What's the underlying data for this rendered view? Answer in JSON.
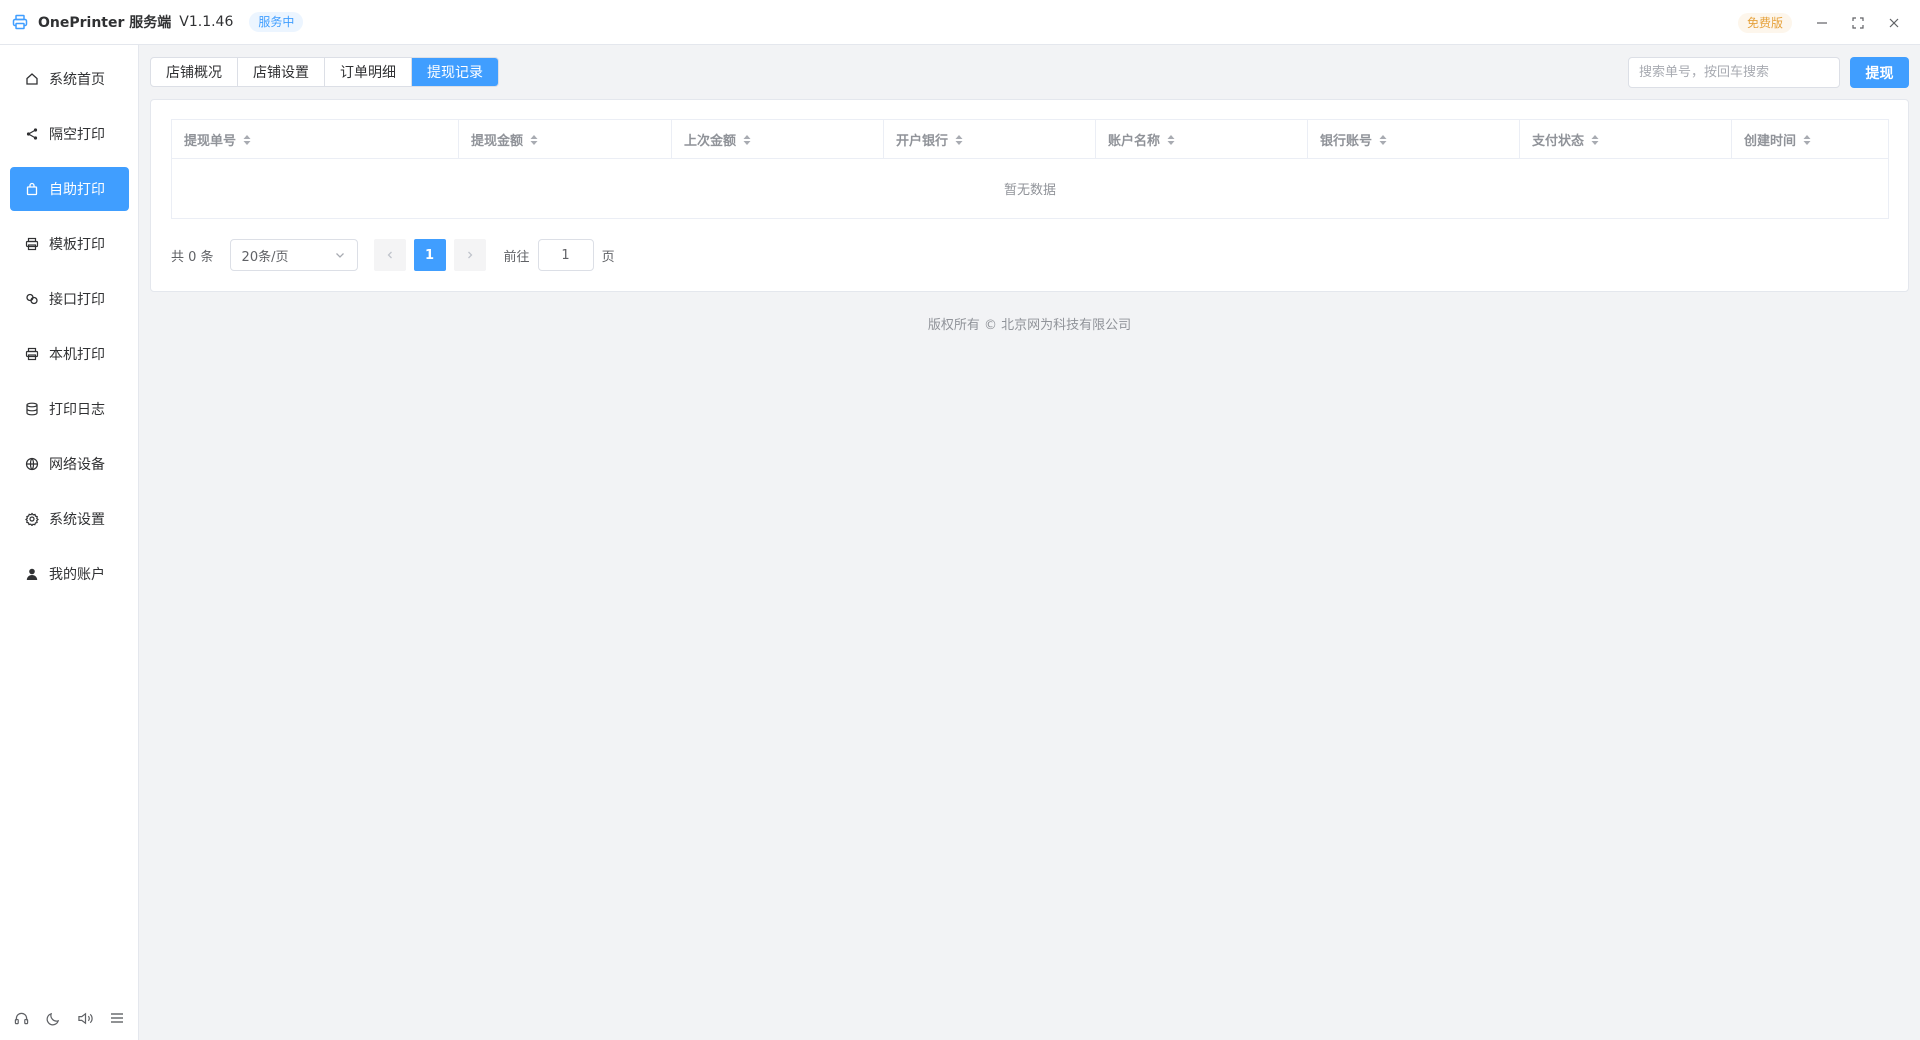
{
  "titlebar": {
    "app_name": "OnePrinter 服务端",
    "version": "V1.1.46",
    "status": "服务中",
    "edition": "免费版"
  },
  "sidebar": {
    "items": [
      {
        "label": "系统首页",
        "icon": "home-icon"
      },
      {
        "label": "隔空打印",
        "icon": "share-icon"
      },
      {
        "label": "自助打印",
        "icon": "shopping-bag-icon"
      },
      {
        "label": "模板打印",
        "icon": "printer-icon"
      },
      {
        "label": "接口打印",
        "icon": "link-icon"
      },
      {
        "label": "本机打印",
        "icon": "printer-icon"
      },
      {
        "label": "打印日志",
        "icon": "database-icon"
      },
      {
        "label": "网络设备",
        "icon": "network-icon"
      },
      {
        "label": "系统设置",
        "icon": "gear-icon"
      },
      {
        "label": "我的账户",
        "icon": "user-icon"
      }
    ],
    "active_index": 2,
    "footer_icons": [
      "headset-icon",
      "moon-icon",
      "speaker-icon",
      "menu-icon"
    ]
  },
  "tabs": [
    {
      "label": "店铺概况"
    },
    {
      "label": "店铺设置"
    },
    {
      "label": "订单明细"
    },
    {
      "label": "提现记录"
    }
  ],
  "active_tab": 3,
  "search": {
    "placeholder": "搜索单号，按回车搜索",
    "value": ""
  },
  "withdraw_button": "提现",
  "table": {
    "columns": [
      "提现单号",
      "提现金额",
      "上次金额",
      "开户银行",
      "账户名称",
      "银行账号",
      "支付状态",
      "创建时间"
    ],
    "rows": [],
    "empty_text": "暂无数据"
  },
  "pagination": {
    "total": "共 0 条",
    "page_size": "20条/页",
    "current_page": "1",
    "goto_label": "前往",
    "goto_value": "1",
    "goto_unit": "页"
  },
  "footer": {
    "copyright": "版权所有 ©  北京网为科技有限公司"
  },
  "colors": {
    "primary": "#409eff",
    "warning": "#e6a23c",
    "background": "#f2f3f5"
  }
}
